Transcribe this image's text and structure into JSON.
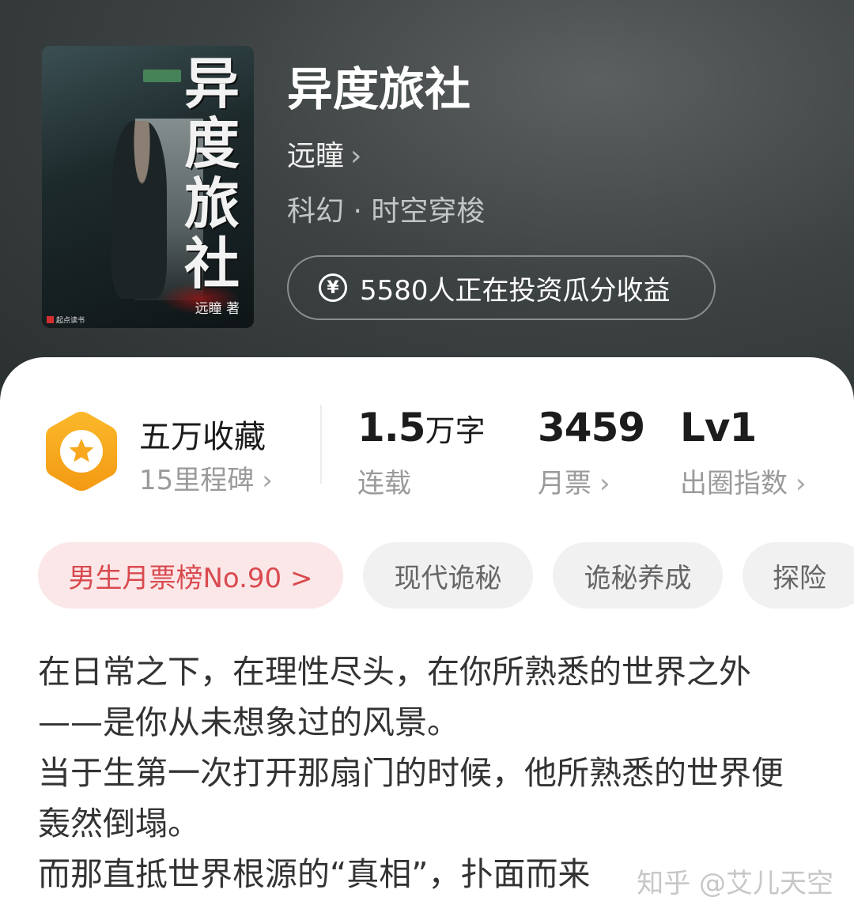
{
  "book": {
    "title": "异度旅社",
    "author": "远瞳",
    "author_chevron": "›",
    "genre": "科幻 · 时空穿梭",
    "invest_text": "5580人正在投资瓜分收益",
    "invest_icon": "yen-coin-icon",
    "cover": {
      "title_text": "异度旅社",
      "author_text": "远瞳 著",
      "publisher_text": "起点读书"
    }
  },
  "stats": {
    "badge_icon": "star-hexagon-icon",
    "badge_color": "#f9a825",
    "collection": {
      "value": "五万收藏",
      "label": "15里程碑"
    },
    "words": {
      "number": "1.5",
      "unit": "万字",
      "label": "连载"
    },
    "monthly_votes": {
      "value": "3459",
      "label": "月票"
    },
    "influence": {
      "value": "Lv1",
      "label": "出圈指数"
    },
    "chevron": "›"
  },
  "tags": [
    {
      "label": "男生月票榜No.90 >",
      "type": "rank"
    },
    {
      "label": "现代诡秘",
      "type": "tag"
    },
    {
      "label": "诡秘养成",
      "type": "tag"
    },
    {
      "label": "探险",
      "type": "tag"
    }
  ],
  "synopsis": [
    "在日常之下，在理性尽头，在你所熟悉的世界之外——是你从未想象过的风景。",
    "当于生第一次打开那扇门的时候，他所熟悉的世界便轰然倒塌。",
    "而那直抵世界根源的“真相”，扑面而来"
  ],
  "watermark": "知乎 @艾儿天空",
  "colors": {
    "accent_red": "#d94a4f",
    "rank_chip_bg": "#fbe7e8",
    "header_bg": "#3d4243"
  }
}
